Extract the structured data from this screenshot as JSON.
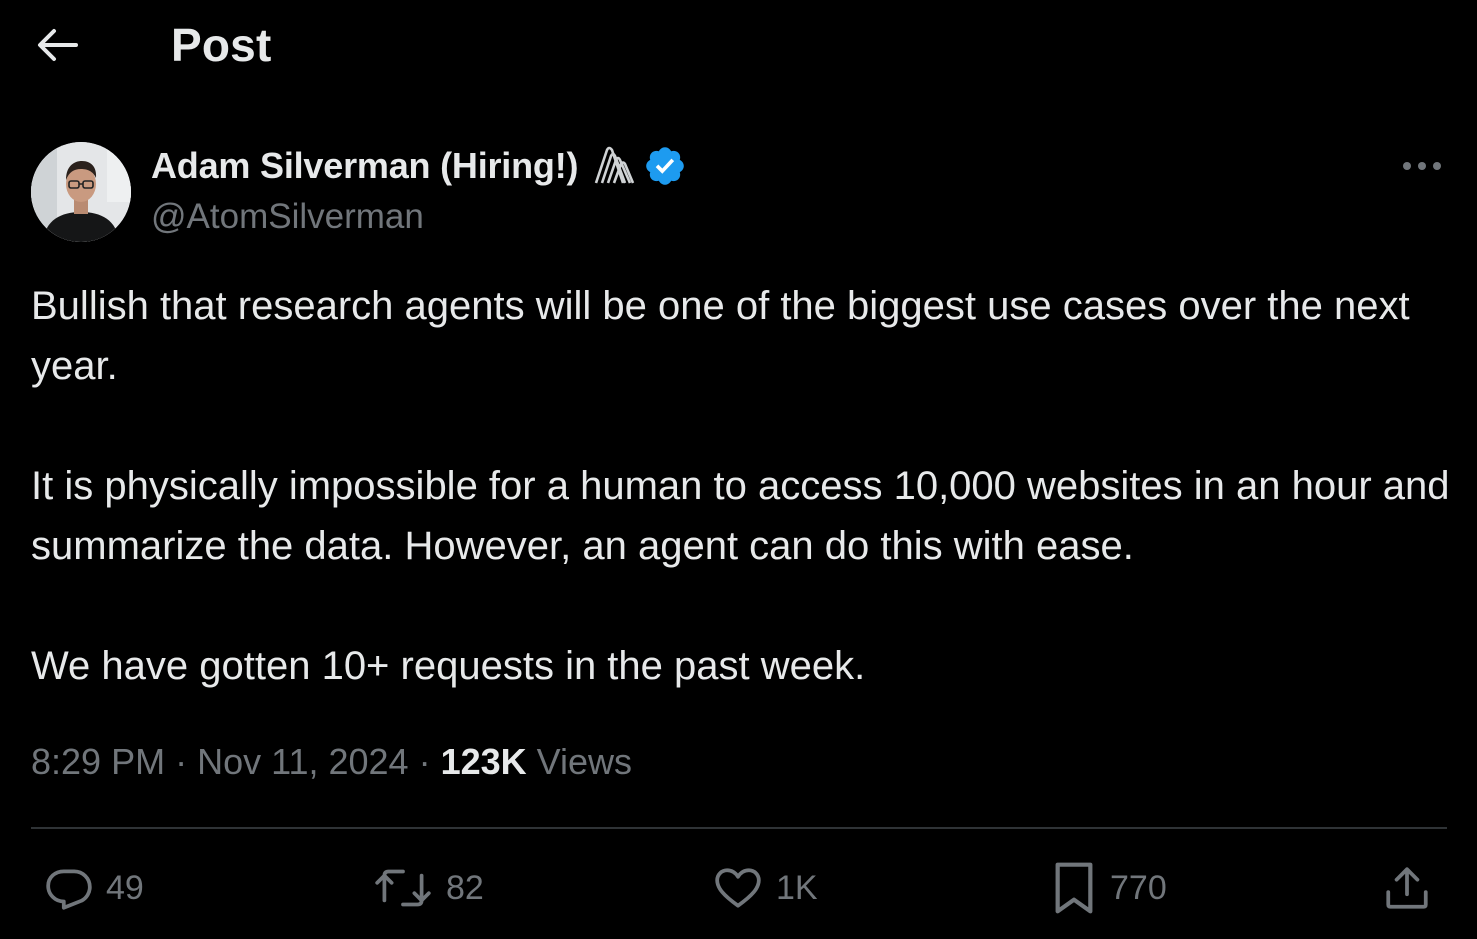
{
  "header": {
    "title": "Post",
    "back_icon": "arrow-left-icon"
  },
  "author": {
    "name": "Adam Silverman (Hiring!)",
    "handle": "@AtomSilverman",
    "affiliate_badge_icon": "agentops-logo-icon",
    "verified_icon": "verified-badge-icon",
    "verified_color": "#1d9bf0"
  },
  "post": {
    "paragraphs": [
      "Bullish that research agents will be one of the biggest use cases over the next year.",
      "It is physically impossible for a human to access 10,000 websites in an hour and summarize the data. However, an agent can do this with ease.",
      "We have gotten 10+ requests in the past week."
    ],
    "time": "8:29 PM",
    "separator": " · ",
    "date": "Nov 11, 2024",
    "views_count": "123K",
    "views_label": " Views"
  },
  "actions": {
    "replies": "49",
    "reposts": "82",
    "likes": "1K",
    "bookmarks": "770"
  },
  "colors": {
    "background": "#000000",
    "text_primary": "#e7e9ea",
    "text_secondary": "#71767b",
    "divider": "#2f3336"
  }
}
